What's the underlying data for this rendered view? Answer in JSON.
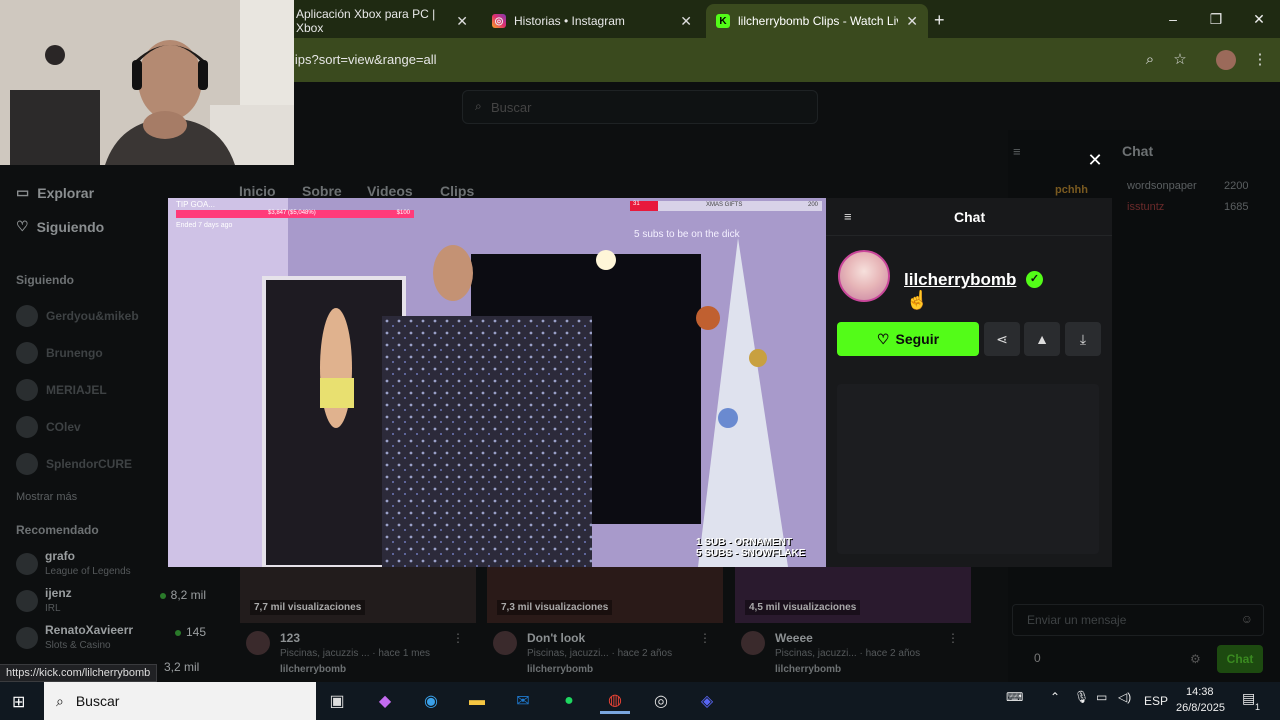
{
  "browser": {
    "tabs": [
      {
        "title": "Aplicación Xbox para PC | Xbox",
        "favicon": "xbox-icon",
        "active": false
      },
      {
        "title": "Historias • Instagram",
        "favicon": "instagram-icon",
        "active": false
      },
      {
        "title": "lilcherrybomb Clips - Watch Liv",
        "favicon": "kick-icon",
        "active": true
      }
    ],
    "new_tab": "+",
    "url": "lips?sort=view&range=all",
    "window_controls": {
      "minimize": "–",
      "maximize": "❐",
      "close": "✕"
    }
  },
  "site": {
    "search_placeholder": "Buscar",
    "nav": {
      "explore": "Explorar",
      "following": "Siguiendo"
    },
    "following_heading": "Siguiendo",
    "following_list": [
      "Gerdyou&mikeb",
      "Brunengo",
      "MERIAJEL",
      "COlev",
      "SplendorCURE"
    ],
    "show_more": "Mostrar más",
    "recommended_heading": "Recomendado",
    "recommended": [
      {
        "name": "grafo",
        "category": "League of Legends",
        "viewers": ""
      },
      {
        "name": "ijenz",
        "category": "IRL",
        "viewers": "8,2 mil"
      },
      {
        "name": "RenatoXavieerr",
        "category": "Slots & Casino",
        "viewers": "145"
      },
      {
        "name": "",
        "category": "",
        "viewers": "3,2 mil"
      }
    ],
    "channel_tabs": [
      "Inicio",
      "Sobre",
      "Videos",
      "Clips"
    ],
    "clips": [
      {
        "views": "7,7 mil visualizaciones",
        "title": "123",
        "sub": "Piscinas, jacuzzis ... · hace 1 mes",
        "author": "lilcherrybomb"
      },
      {
        "views": "7,3 mil visualizaciones",
        "title": "Don't look",
        "sub": "Piscinas, jacuzzi... · hace 2 años",
        "author": "lilcherrybomb"
      },
      {
        "views": "4,5 mil visualizaciones",
        "title": "Weeee",
        "sub": "Piscinas, jacuzzi... · hace 2 años",
        "author": "lilcherrybomb"
      }
    ],
    "side_chat": {
      "title": "Chat",
      "leaders": [
        {
          "name": "pchhh",
          "user": "wordsonpaper",
          "count": "2200"
        },
        {
          "name": "",
          "user": "isstuntz",
          "count": "1685"
        }
      ],
      "input_placeholder": "Enviar un mensaje",
      "points": "0",
      "send": "Chat"
    }
  },
  "modal": {
    "close": "✕",
    "chat_title": "Chat",
    "channel": "lilcherrybomb",
    "follow_label": "Seguir",
    "video_overlays": {
      "tip_goal": "TIP GOA...",
      "goal_amount": "$3,847 ($5,048%)",
      "goal_end": "$100",
      "ended": "Ended 7 days ago",
      "gifts_count": "31",
      "xmas_gifts": "XMAS GIFTS",
      "gifts_total": "200",
      "subs_msg": "5 subs to be on the dick",
      "sub1": "1 SUB - ORNAMENT",
      "sub5": "5 SUBS - SNOWFLAKE"
    }
  },
  "status_link": "https://kick.com/lilcherrybomb",
  "taskbar": {
    "search": "Buscar",
    "lang": "ESP",
    "time": "14:38",
    "date": "26/8/2025",
    "notif_count": "1"
  },
  "colors": {
    "kick_green": "#53fc18",
    "panel_bg": "#18191b",
    "tab_bar": "#1f2a12"
  }
}
